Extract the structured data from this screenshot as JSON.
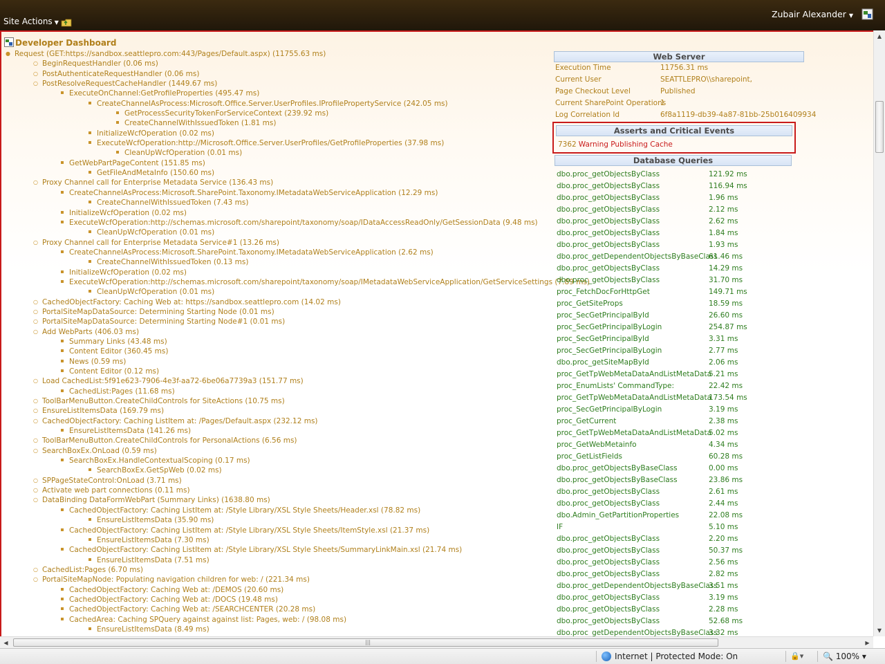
{
  "topbar": {
    "site_actions": "Site Actions",
    "user_name": "Zubair Alexander"
  },
  "dashboard": {
    "title": "Developer Dashboard",
    "tree": [
      {
        "level": 0,
        "text": "Request (GET:https://sandbox.seattlepro.com:443/Pages/Default.aspx) (11755.63 ms)"
      },
      {
        "level": 1,
        "text": "BeginRequestHandler (0.06 ms)"
      },
      {
        "level": 1,
        "text": "PostAuthenticateRequestHandler (0.06 ms)"
      },
      {
        "level": 1,
        "text": "PostResolveRequestCacheHandler (1449.67 ms)"
      },
      {
        "level": 2,
        "text": "ExecuteOnChannel:GetProfileProperties (495.47 ms)"
      },
      {
        "level": 3,
        "text": "CreateChannelAsProcess:Microsoft.Office.Server.UserProfiles.IProfilePropertyService (242.05 ms)"
      },
      {
        "level": 4,
        "text": "GetProcessSecurityTokenForServiceContext (239.92 ms)"
      },
      {
        "level": 4,
        "text": "CreateChannelWithIssuedToken (1.81 ms)"
      },
      {
        "level": 3,
        "text": "InitializeWcfOperation (0.02 ms)"
      },
      {
        "level": 3,
        "text": "ExecuteWcfOperation:http://Microsoft.Office.Server.UserProfiles/GetProfileProperties (37.98 ms)"
      },
      {
        "level": 4,
        "text": "CleanUpWcfOperation (0.01 ms)"
      },
      {
        "level": 2,
        "text": "GetWebPartPageContent (151.85 ms)"
      },
      {
        "level": 3,
        "text": "GetFileAndMetaInfo (150.60 ms)"
      },
      {
        "level": 1,
        "text": "Proxy Channel call for Enterprise Metadata Service (136.43 ms)"
      },
      {
        "level": 2,
        "text": "CreateChannelAsProcess:Microsoft.SharePoint.Taxonomy.IMetadataWebServiceApplication (12.29 ms)"
      },
      {
        "level": 3,
        "text": "CreateChannelWithIssuedToken (7.43 ms)"
      },
      {
        "level": 2,
        "text": "InitializeWcfOperation (0.02 ms)"
      },
      {
        "level": 2,
        "text": "ExecuteWcfOperation:http://schemas.microsoft.com/sharepoint/taxonomy/soap/IDataAccessReadOnly/GetSessionData (9.48 ms)"
      },
      {
        "level": 3,
        "text": "CleanUpWcfOperation (0.01 ms)"
      },
      {
        "level": 1,
        "text": "Proxy Channel call for Enterprise Metadata Service#1 (13.26 ms)"
      },
      {
        "level": 2,
        "text": "CreateChannelAsProcess:Microsoft.SharePoint.Taxonomy.IMetadataWebServiceApplication (2.62 ms)"
      },
      {
        "level": 3,
        "text": "CreateChannelWithIssuedToken (0.13 ms)"
      },
      {
        "level": 2,
        "text": "InitializeWcfOperation (0.02 ms)"
      },
      {
        "level": 2,
        "text": "ExecuteWcfOperation:http://schemas.microsoft.com/sharepoint/taxonomy/soap/IMetadataWebServiceApplication/GetServiceSettings (7.89 ms)"
      },
      {
        "level": 3,
        "text": "CleanUpWcfOperation (0.01 ms)"
      },
      {
        "level": 1,
        "text": "CachedObjectFactory: Caching Web at: https://sandbox.seattlepro.com (14.02 ms)"
      },
      {
        "level": 1,
        "text": "PortalSiteMapDataSource: Determining Starting Node (0.01 ms)"
      },
      {
        "level": 1,
        "text": "PortalSiteMapDataSource: Determining Starting Node#1 (0.01 ms)"
      },
      {
        "level": 1,
        "text": "Add WebParts (406.03 ms)"
      },
      {
        "level": 2,
        "text": "Summary Links (43.48 ms)"
      },
      {
        "level": 2,
        "text": "Content Editor (360.45 ms)"
      },
      {
        "level": 2,
        "text": "News (0.59 ms)"
      },
      {
        "level": 2,
        "text": "Content Editor (0.12 ms)"
      },
      {
        "level": 1,
        "text": "Load CachedList:5f91e623-7906-4e3f-aa72-6be06a7739a3 (151.77 ms)"
      },
      {
        "level": 2,
        "text": "CachedList:Pages (11.68 ms)"
      },
      {
        "level": 1,
        "text": "ToolBarMenuButton.CreateChildControls for SiteActions (10.75 ms)"
      },
      {
        "level": 1,
        "text": "EnsureListItemsData (169.79 ms)"
      },
      {
        "level": 1,
        "text": "CachedObjectFactory: Caching ListItem at: /Pages/Default.aspx (232.12 ms)"
      },
      {
        "level": 2,
        "text": "EnsureListItemsData (141.26 ms)"
      },
      {
        "level": 1,
        "text": "ToolBarMenuButton.CreateChildControls for PersonalActions (6.56 ms)"
      },
      {
        "level": 1,
        "text": "SearchBoxEx.OnLoad (0.59 ms)"
      },
      {
        "level": 2,
        "text": "SearchBoxEx.HandleContextualScoping (0.17 ms)"
      },
      {
        "level": 3,
        "text": "SearchBoxEx.GetSpWeb (0.02 ms)"
      },
      {
        "level": 1,
        "text": "SPPageStateControl:OnLoad (3.71 ms)"
      },
      {
        "level": 1,
        "text": "Activate web part connections (0.11 ms)"
      },
      {
        "level": 1,
        "text": "DataBinding DataFormWebPart (Summary Links) (1638.80 ms)"
      },
      {
        "level": 2,
        "text": "CachedObjectFactory: Caching ListItem at: /Style Library/XSL Style Sheets/Header.xsl (78.82 ms)"
      },
      {
        "level": 3,
        "text": "EnsureListItemsData (35.90 ms)"
      },
      {
        "level": 2,
        "text": "CachedObjectFactory: Caching ListItem at: /Style Library/XSL Style Sheets/ItemStyle.xsl (21.37 ms)"
      },
      {
        "level": 3,
        "text": "EnsureListItemsData (7.30 ms)"
      },
      {
        "level": 2,
        "text": "CachedObjectFactory: Caching ListItem at: /Style Library/XSL Style Sheets/SummaryLinkMain.xsl (21.74 ms)"
      },
      {
        "level": 3,
        "text": "EnsureListItemsData (7.51 ms)"
      },
      {
        "level": 1,
        "text": "CachedList:Pages (6.70 ms)"
      },
      {
        "level": 1,
        "text": "PortalSiteMapNode: Populating navigation children for web: / (221.34 ms)"
      },
      {
        "level": 2,
        "text": "CachedObjectFactory: Caching Web at: /DEMOS (20.60 ms)"
      },
      {
        "level": 2,
        "text": "CachedObjectFactory: Caching Web at: /DOCS (19.48 ms)"
      },
      {
        "level": 2,
        "text": "CachedObjectFactory: Caching Web at: /SEARCHCENTER (20.28 ms)"
      },
      {
        "level": 2,
        "text": "CachedArea: Caching SPQuery against against list: Pages, web: / (98.08 ms)"
      },
      {
        "level": 3,
        "text": "EnsureListItemsData (8.49 ms)"
      }
    ]
  },
  "web_server": {
    "title": "Web Server",
    "rows": [
      {
        "key": "Execution Time",
        "value": "11756.31 ms"
      },
      {
        "key": "Current User",
        "value": "SEATTLEPRO\\\\sharepoint,"
      },
      {
        "key": "Page Checkout Level",
        "value": "Published"
      },
      {
        "key": "Current SharePoint Operations",
        "value": "1"
      },
      {
        "key": "Log Correlation Id",
        "value": "6f8a1119-db39-4a87-81bb-25b016409934"
      }
    ]
  },
  "asserts": {
    "title": "Asserts and Critical Events",
    "id": "7362",
    "text": "Warning Publishing Cache"
  },
  "database": {
    "title": "Database Queries",
    "rows": [
      {
        "query": "dbo.proc_getObjectsByClass",
        "time": "121.92 ms"
      },
      {
        "query": "dbo.proc_getObjectsByClass",
        "time": "116.94 ms"
      },
      {
        "query": "dbo.proc_getObjectsByClass",
        "time": "1.96 ms"
      },
      {
        "query": "dbo.proc_getObjectsByClass",
        "time": "2.12 ms"
      },
      {
        "query": "dbo.proc_getObjectsByClass",
        "time": "2.62 ms"
      },
      {
        "query": "dbo.proc_getObjectsByClass",
        "time": "1.84 ms"
      },
      {
        "query": "dbo.proc_getObjectsByClass",
        "time": "1.93 ms"
      },
      {
        "query": "dbo.proc_getDependentObjectsByBaseClass",
        "time": "61.46 ms"
      },
      {
        "query": "dbo.proc_getObjectsByClass",
        "time": "14.29 ms"
      },
      {
        "query": "dbo.proc_getObjectsByClass",
        "time": "31.70 ms"
      },
      {
        "query": "proc_FetchDocForHttpGet",
        "time": "149.71 ms"
      },
      {
        "query": "proc_GetSiteProps",
        "time": "18.59 ms"
      },
      {
        "query": "proc_SecGetPrincipalById",
        "time": "26.60 ms"
      },
      {
        "query": "proc_SecGetPrincipalByLogin",
        "time": "254.87 ms"
      },
      {
        "query": "proc_SecGetPrincipalById",
        "time": "3.31 ms"
      },
      {
        "query": "proc_SecGetPrincipalByLogin",
        "time": "2.77 ms"
      },
      {
        "query": "dbo.proc_getSiteMapById",
        "time": "2.06 ms"
      },
      {
        "query": "proc_GetTpWebMetaDataAndListMetaData",
        "time": "5.21 ms"
      },
      {
        "query": "proc_EnumLists' CommandType:",
        "time": "22.42 ms"
      },
      {
        "query": "proc_GetTpWebMetaDataAndListMetaData",
        "time": "173.54 ms"
      },
      {
        "query": "proc_SecGetPrincipalByLogin",
        "time": "3.19 ms"
      },
      {
        "query": "proc_GetCurrent",
        "time": "2.38 ms"
      },
      {
        "query": "proc_GetTpWebMetaDataAndListMetaData",
        "time": "5.02 ms"
      },
      {
        "query": "proc_GetWebMetainfo",
        "time": "4.34 ms"
      },
      {
        "query": "proc_GetListFields",
        "time": "60.28 ms"
      },
      {
        "query": "dbo.proc_getObjectsByBaseClass",
        "time": "0.00 ms"
      },
      {
        "query": "dbo.proc_getObjectsByBaseClass",
        "time": "23.86 ms"
      },
      {
        "query": "dbo.proc_getObjectsByClass",
        "time": "2.61 ms"
      },
      {
        "query": "dbo.proc_getObjectsByClass",
        "time": "2.44 ms"
      },
      {
        "query": "dbo.Admin_GetPartitionProperties",
        "time": "22.08 ms"
      },
      {
        "query": "IF",
        "time": "5.10 ms"
      },
      {
        "query": "dbo.proc_getObjectsByClass",
        "time": "2.20 ms"
      },
      {
        "query": "dbo.proc_getObjectsByClass",
        "time": "50.37 ms"
      },
      {
        "query": "dbo.proc_getObjectsByClass",
        "time": "2.56 ms"
      },
      {
        "query": "dbo.proc_getObjectsByClass",
        "time": "2.82 ms"
      },
      {
        "query": "dbo.proc_getDependentObjectsByBaseClass",
        "time": "3.51 ms"
      },
      {
        "query": "dbo.proc_getObjectsByClass",
        "time": "3.19 ms"
      },
      {
        "query": "dbo.proc_getObjectsByClass",
        "time": "2.28 ms"
      },
      {
        "query": "dbo.proc_getObjectsByClass",
        "time": "52.68 ms"
      },
      {
        "query": "dbo.proc_getDependentObjectsByBaseClass",
        "time": "3.32 ms"
      }
    ]
  },
  "statusbar": {
    "zone": "Internet | Protected Mode: On",
    "zoom": "100%"
  },
  "colors": {
    "tree_text": "#b0801c",
    "db_text": "#2e7d1f",
    "alert_red": "#c81a1a",
    "ribbon": "#2a1e0c"
  }
}
